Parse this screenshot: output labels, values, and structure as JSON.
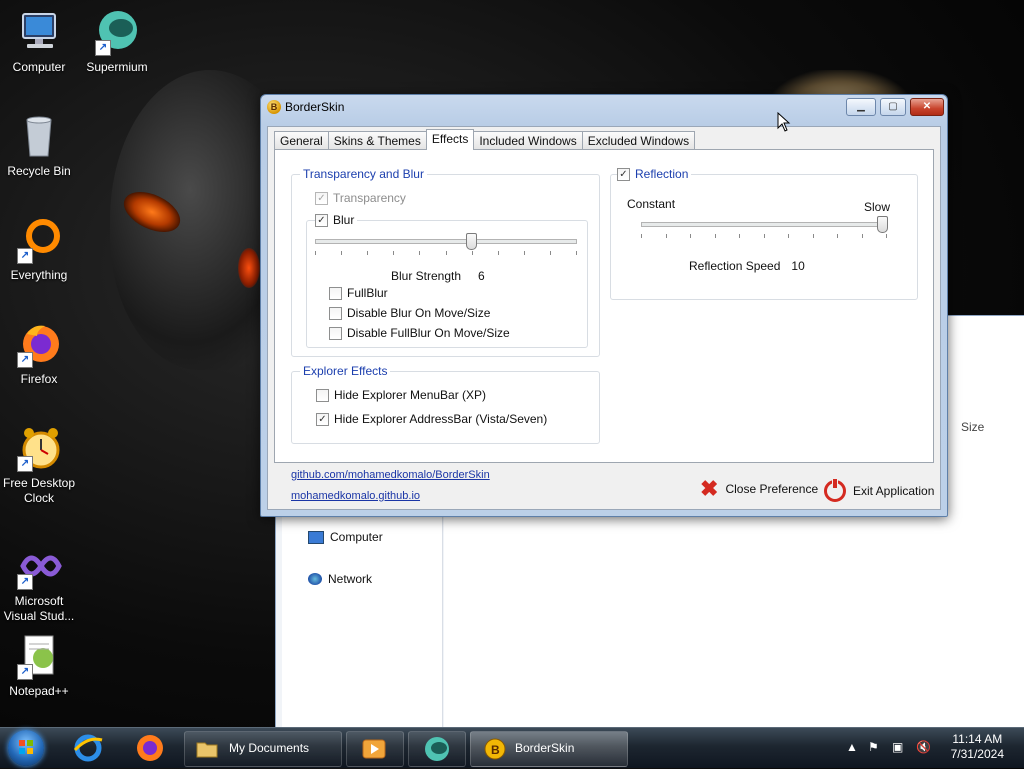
{
  "desktop": {
    "icons": [
      {
        "label": "Computer"
      },
      {
        "label": "Supermium"
      },
      {
        "label": "Recycle Bin"
      },
      {
        "label": "Everything"
      },
      {
        "label": "Firefox"
      },
      {
        "label": "Free Desktop Clock"
      },
      {
        "label": "Microsoft Visual Stud..."
      },
      {
        "label": "Notepad++"
      }
    ]
  },
  "explorer_bg": {
    "nav": [
      {
        "label": "Computer"
      },
      {
        "label": "Network"
      }
    ],
    "column_header": "Size"
  },
  "window": {
    "title": "BorderSkin",
    "tabs": [
      {
        "label": "General"
      },
      {
        "label": "Skins & Themes"
      },
      {
        "label": "Effects"
      },
      {
        "label": "Included Windows"
      },
      {
        "label": "Excluded Windows"
      }
    ],
    "active_tab": "Effects",
    "transparency_group": {
      "title": "Transparency and Blur",
      "transparency": {
        "label": "Transparency",
        "checked": true,
        "enabled": false
      },
      "blur": {
        "label": "Blur",
        "checked": true
      },
      "blur_strength_label": "Blur Strength",
      "blur_strength_value": "6",
      "blur_slider_level": 0.6,
      "fullblur": {
        "label": "FullBlur",
        "checked": false
      },
      "disable_blur_move": {
        "label": "Disable Blur On Move/Size",
        "checked": false
      },
      "disable_fullblur_move": {
        "label": "Disable FullBlur On Move/Size",
        "checked": false
      }
    },
    "reflection_group": {
      "title": "Reflection",
      "checked": true,
      "min_label": "Constant",
      "max_label": "Slow",
      "speed_label": "Reflection Speed",
      "speed_value": "10",
      "slider_level": 1.0
    },
    "explorer_group": {
      "title": "Explorer Effects",
      "hide_menubar": {
        "label": "Hide Explorer MenuBar (XP)",
        "checked": false
      },
      "hide_addressbar": {
        "label": "Hide Explorer AddressBar (Vista/Seven)",
        "checked": true
      }
    },
    "links": [
      "github.com/mohamedkomalo/BorderSkin",
      "mohamedkomalo.github.io"
    ],
    "close_preference": "Close Preference",
    "exit_application": "Exit Application"
  },
  "taskbar": {
    "items": [
      {
        "label": "My Documents"
      },
      {
        "label": "BorderSkin"
      }
    ],
    "time": "11:14 AM",
    "date": "7/31/2024"
  }
}
